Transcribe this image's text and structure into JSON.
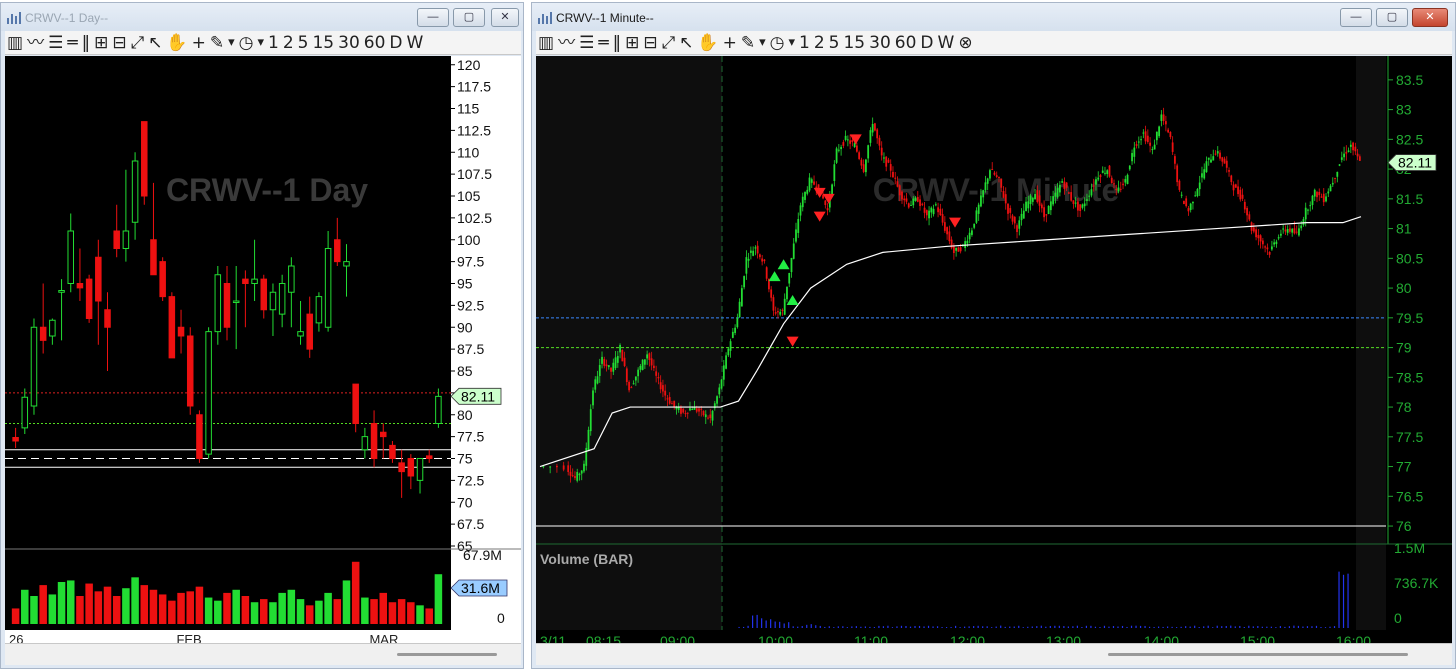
{
  "left_window": {
    "title": "CRWV--1 Day--",
    "watermark": "CRWV--1 Day",
    "toolbar": [
      "1",
      "2",
      "5",
      "15",
      "30",
      "60",
      "D",
      "W"
    ],
    "price_ticks": [
      "120",
      "117.5",
      "115",
      "112.5",
      "110",
      "107.5",
      "105",
      "102.5",
      "100",
      "97.5",
      "95",
      "92.5",
      "90",
      "87.5",
      "85",
      "82.5",
      "80",
      "77.5",
      "75",
      "72.5",
      "70",
      "67.5",
      "65"
    ],
    "last_price": "82.11",
    "volume_max": "67.9M",
    "volume_current": "31.6M",
    "volume_zero": "0",
    "x_labels": [
      "26",
      "FEB",
      "MAR"
    ]
  },
  "right_window": {
    "title": "CRWV--1 Minute--",
    "watermark": "CRWV--1 Minute",
    "toolbar": [
      "1",
      "2",
      "5",
      "15",
      "30",
      "60",
      "D",
      "W"
    ],
    "price_ticks": [
      "83.5",
      "83",
      "82.5",
      "82",
      "81.5",
      "81",
      "80.5",
      "80",
      "79.5",
      "79",
      "78.5",
      "78",
      "77.5",
      "77",
      "76.5",
      "76"
    ],
    "last_price": "82.11",
    "volume_pane_label": "Volume (BAR)",
    "volume_ticks": [
      "1.5M",
      "736.7K",
      "0"
    ],
    "x_labels": [
      "3/11",
      "08:15",
      "09:00",
      "10:00",
      "11:00",
      "12:00",
      "13:00",
      "14:00",
      "15:00",
      "16:00"
    ]
  },
  "colors": {
    "up": "#22dd33",
    "down": "#ee1111",
    "axis_green": "#22aa33",
    "vwap": "#ffffff",
    "dotted_blue": "#3a88ff",
    "dotted_green": "#55dd22",
    "dotted_red": "#dd2222"
  },
  "chart_data": [
    {
      "type": "candlestick",
      "title": "CRWV--1 Day",
      "ylim": [
        65,
        121
      ],
      "last": 82.11,
      "x_ticks": [
        "26",
        "FEB",
        "MAR"
      ],
      "candles": [
        {
          "o": 77.4,
          "h": 78.5,
          "l": 76.2,
          "c": 77.0
        },
        {
          "o": 78.5,
          "h": 83.0,
          "l": 77.8,
          "c": 82.0
        },
        {
          "o": 81.0,
          "h": 91.0,
          "l": 80.0,
          "c": 90.0
        },
        {
          "o": 90.0,
          "h": 95.0,
          "l": 87.0,
          "c": 88.5
        },
        {
          "o": 89.0,
          "h": 91.0,
          "l": 88.0,
          "c": 90.8
        },
        {
          "o": 94.0,
          "h": 95.5,
          "l": 88.5,
          "c": 94.2
        },
        {
          "o": 95.0,
          "h": 103.0,
          "l": 94.0,
          "c": 101.0
        },
        {
          "o": 95.0,
          "h": 99.0,
          "l": 93.0,
          "c": 94.5
        },
        {
          "o": 95.5,
          "h": 96.0,
          "l": 90.5,
          "c": 91.0
        },
        {
          "o": 98.0,
          "h": 100.0,
          "l": 88.0,
          "c": 93.0
        },
        {
          "o": 92.0,
          "h": 94.0,
          "l": 85.0,
          "c": 90.0
        },
        {
          "o": 101.0,
          "h": 104.0,
          "l": 98.0,
          "c": 99.0
        },
        {
          "o": 99.0,
          "h": 108.0,
          "l": 97.5,
          "c": 101.0
        },
        {
          "o": 102.0,
          "h": 110.0,
          "l": 100.0,
          "c": 109.0
        },
        {
          "o": 113.5,
          "h": 113.5,
          "l": 104.0,
          "c": 105.0
        },
        {
          "o": 100.0,
          "h": 106.5,
          "l": 96.0,
          "c": 96.0
        },
        {
          "o": 97.5,
          "h": 98.0,
          "l": 93.0,
          "c": 93.5
        },
        {
          "o": 93.5,
          "h": 94.0,
          "l": 86.5,
          "c": 86.5
        },
        {
          "o": 90.0,
          "h": 92.0,
          "l": 87.0,
          "c": 89.0
        },
        {
          "o": 89.0,
          "h": 90.0,
          "l": 80.0,
          "c": 81.0
        },
        {
          "o": 80.0,
          "h": 80.5,
          "l": 74.5,
          "c": 75.0
        },
        {
          "o": 75.5,
          "h": 90.0,
          "l": 75.0,
          "c": 89.5
        },
        {
          "o": 89.5,
          "h": 97.0,
          "l": 88.0,
          "c": 96.0
        },
        {
          "o": 95.0,
          "h": 97.0,
          "l": 88.5,
          "c": 90.0
        },
        {
          "o": 93.0,
          "h": 97.0,
          "l": 87.5,
          "c": 93.0
        },
        {
          "o": 95.5,
          "h": 96.5,
          "l": 90.0,
          "c": 95.0
        },
        {
          "o": 95.0,
          "h": 100.0,
          "l": 93.0,
          "c": 95.5
        },
        {
          "o": 95.5,
          "h": 96.0,
          "l": 91.0,
          "c": 92.0
        },
        {
          "o": 92.0,
          "h": 95.0,
          "l": 89.0,
          "c": 94.0
        },
        {
          "o": 91.5,
          "h": 96.0,
          "l": 90.0,
          "c": 95.0
        },
        {
          "o": 94.0,
          "h": 98.0,
          "l": 90.0,
          "c": 97.0
        },
        {
          "o": 89.0,
          "h": 93.0,
          "l": 88.0,
          "c": 89.5
        },
        {
          "o": 91.5,
          "h": 93.5,
          "l": 86.5,
          "c": 87.5
        },
        {
          "o": 90.5,
          "h": 94.0,
          "l": 89.5,
          "c": 93.5
        },
        {
          "o": 90.0,
          "h": 101.0,
          "l": 89.5,
          "c": 99.0
        },
        {
          "o": 100.0,
          "h": 102.5,
          "l": 97.0,
          "c": 97.5
        },
        {
          "o": 97.0,
          "h": 99.5,
          "l": 93.5,
          "c": 97.5
        },
        {
          "o": 83.5,
          "h": 83.5,
          "l": 78.0,
          "c": 79.0
        },
        {
          "o": 76.0,
          "h": 78.5,
          "l": 75.0,
          "c": 77.5
        },
        {
          "o": 79.0,
          "h": 80.5,
          "l": 74.0,
          "c": 75.0
        },
        {
          "o": 78.0,
          "h": 79.0,
          "l": 75.0,
          "c": 77.5
        },
        {
          "o": 76.5,
          "h": 77.0,
          "l": 74.5,
          "c": 75.0
        },
        {
          "o": 74.5,
          "h": 76.0,
          "l": 70.5,
          "c": 73.5
        },
        {
          "o": 75.0,
          "h": 75.5,
          "l": 71.5,
          "c": 73.0
        },
        {
          "o": 72.5,
          "h": 75.0,
          "l": 71.0,
          "c": 75.0
        },
        {
          "o": 75.3,
          "h": 76.0,
          "l": 74.5,
          "c": 75.0
        },
        {
          "o": 79.0,
          "h": 83.0,
          "l": 78.5,
          "c": 82.1
        }
      ],
      "volume": [
        10,
        22,
        18,
        25,
        19,
        27,
        28,
        18,
        26,
        21,
        24,
        18,
        23,
        30,
        25,
        22,
        19,
        15,
        20,
        21,
        24,
        17,
        15,
        20,
        22,
        18,
        14,
        16,
        14,
        20,
        22,
        16,
        12,
        15,
        20,
        16,
        28,
        40,
        17,
        16,
        20,
        14,
        16,
        14,
        12,
        10,
        32
      ],
      "levels": [
        {
          "price": 82.5,
          "style": "dotted",
          "color": "red"
        },
        {
          "price": 79.0,
          "style": "dotted",
          "color": "green"
        },
        {
          "price": 76.0,
          "style": "solid",
          "color": "white"
        },
        {
          "price": 75.0,
          "style": "dashed",
          "color": "white"
        },
        {
          "price": 74.0,
          "style": "solid",
          "color": "white"
        }
      ]
    },
    {
      "type": "candlestick",
      "title": "CRWV--1 Minute",
      "ylim": [
        75.9,
        83.8
      ],
      "last": 82.11,
      "x_ticks": [
        "3/11",
        "08:15",
        "09:00",
        "10:00",
        "11:00",
        "12:00",
        "13:00",
        "14:00",
        "15:00",
        "16:00"
      ],
      "price_path": [
        [
          0,
          77.0
        ],
        [
          3,
          77.0
        ],
        [
          4,
          76.8
        ],
        [
          5,
          77.0
        ],
        [
          6,
          78.3
        ],
        [
          7,
          78.8
        ],
        [
          8,
          78.6
        ],
        [
          9,
          79.0
        ],
        [
          10,
          78.3
        ],
        [
          11,
          78.6
        ],
        [
          12,
          78.9
        ],
        [
          13,
          78.5
        ],
        [
          14,
          78.2
        ],
        [
          15,
          78.0
        ],
        [
          16,
          77.9
        ],
        [
          17,
          78.0
        ],
        [
          18,
          77.9
        ],
        [
          19,
          77.8
        ],
        [
          20,
          78.3
        ],
        [
          21,
          79.0
        ],
        [
          22,
          79.5
        ],
        [
          23,
          80.5
        ],
        [
          24,
          80.7
        ],
        [
          25,
          80.4
        ],
        [
          26,
          79.6
        ],
        [
          27,
          79.6
        ],
        [
          28,
          80.5
        ],
        [
          29,
          81.4
        ],
        [
          30,
          81.8
        ],
        [
          31,
          81.7
        ],
        [
          32,
          81.3
        ],
        [
          33,
          82.3
        ],
        [
          34,
          82.5
        ],
        [
          35,
          82.4
        ],
        [
          36,
          82.0
        ],
        [
          37,
          82.8
        ],
        [
          38,
          82.2
        ],
        [
          39,
          82.0
        ],
        [
          40,
          81.6
        ],
        [
          41,
          81.4
        ],
        [
          42,
          81.5
        ],
        [
          43,
          81.2
        ],
        [
          44,
          81.4
        ],
        [
          45,
          81.0
        ],
        [
          46,
          80.6
        ],
        [
          47,
          80.7
        ],
        [
          48,
          81.0
        ],
        [
          49,
          81.5
        ],
        [
          50,
          82.0
        ],
        [
          51,
          81.8
        ],
        [
          52,
          81.3
        ],
        [
          53,
          81.0
        ],
        [
          54,
          81.4
        ],
        [
          55,
          81.6
        ],
        [
          56,
          81.2
        ],
        [
          57,
          81.5
        ],
        [
          58,
          81.8
        ],
        [
          59,
          81.5
        ],
        [
          60,
          81.3
        ],
        [
          61,
          81.6
        ],
        [
          62,
          81.9
        ],
        [
          63,
          82.0
        ],
        [
          64,
          81.6
        ],
        [
          65,
          81.8
        ],
        [
          66,
          82.4
        ],
        [
          67,
          82.6
        ],
        [
          68,
          82.3
        ],
        [
          69,
          82.9
        ],
        [
          70,
          82.5
        ],
        [
          71,
          81.6
        ],
        [
          72,
          81.3
        ],
        [
          73,
          81.7
        ],
        [
          74,
          82.1
        ],
        [
          75,
          82.3
        ],
        [
          76,
          82.1
        ],
        [
          77,
          81.7
        ],
        [
          78,
          81.5
        ],
        [
          79,
          81.0
        ],
        [
          80,
          80.8
        ],
        [
          81,
          80.6
        ],
        [
          82,
          80.9
        ],
        [
          83,
          81.0
        ],
        [
          84,
          80.9
        ],
        [
          85,
          81.3
        ],
        [
          86,
          81.6
        ],
        [
          87,
          81.5
        ],
        [
          88,
          81.8
        ],
        [
          89,
          82.2
        ],
        [
          90,
          82.4
        ],
        [
          91,
          82.11
        ]
      ],
      "vwap": [
        [
          0,
          77.0
        ],
        [
          6,
          77.3
        ],
        [
          8,
          77.9
        ],
        [
          10,
          78.0
        ],
        [
          20,
          78.0
        ],
        [
          22,
          78.1
        ],
        [
          24,
          78.6
        ],
        [
          27,
          79.4
        ],
        [
          30,
          80.0
        ],
        [
          34,
          80.4
        ],
        [
          38,
          80.6
        ],
        [
          45,
          80.7
        ],
        [
          55,
          80.8
        ],
        [
          65,
          80.9
        ],
        [
          75,
          81.0
        ],
        [
          85,
          81.1
        ],
        [
          89,
          81.1
        ],
        [
          91,
          81.2
        ]
      ],
      "up_arrows": [
        [
          26,
          80.2
        ],
        [
          27,
          80.4
        ],
        [
          28,
          79.8
        ]
      ],
      "down_arrows": [
        [
          28,
          79.1
        ],
        [
          31,
          81.2
        ],
        [
          31,
          81.6
        ],
        [
          32,
          81.5
        ],
        [
          35,
          82.5
        ],
        [
          46,
          81.1
        ]
      ],
      "volume_spikes": [
        [
          24,
          0.18
        ],
        [
          25,
          0.12
        ],
        [
          26,
          0.09
        ],
        [
          27,
          0.08
        ],
        [
          30,
          0.05
        ],
        [
          40,
          0.03
        ],
        [
          89,
          1.0
        ]
      ],
      "levels": [
        {
          "price": 79.5,
          "style": "dotted",
          "color": "blue"
        },
        {
          "price": 79.0,
          "style": "dotted",
          "color": "green"
        },
        {
          "price": 76.0,
          "style": "solid",
          "color": "white"
        }
      ]
    }
  ]
}
